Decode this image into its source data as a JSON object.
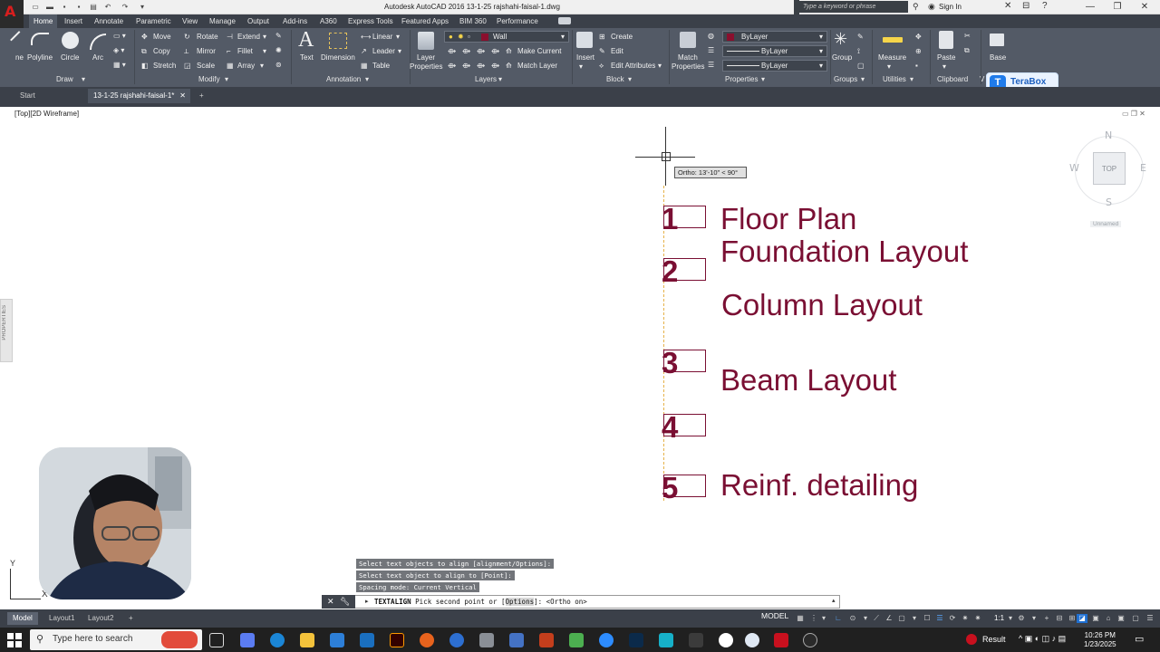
{
  "app": {
    "window_title": "Autodesk AutoCAD 2016    13-1-25 rajshahi-faisal-1.dwg",
    "search_placeholder": "Type a keyword or phrase",
    "sign_in": "Sign In"
  },
  "ribbon": {
    "tabs": [
      "Home",
      "Insert",
      "Annotate",
      "Parametric",
      "View",
      "Manage",
      "Output",
      "Add-ins",
      "A360",
      "Express Tools",
      "Featured Apps",
      "BIM 360",
      "Performance"
    ],
    "active_tab": "Home",
    "draw": {
      "title": "Draw",
      "polyline": "Polyline",
      "circle": "Circle",
      "arc": "Arc",
      "line_partial": "ne"
    },
    "modify": {
      "title": "Modify",
      "move": "Move",
      "rotate": "Rotate",
      "extend": "Extend",
      "copy": "Copy",
      "mirror": "Mirror",
      "fillet": "Fillet",
      "stretch": "Stretch",
      "scale": "Scale",
      "array": "Array"
    },
    "annotation": {
      "title": "Annotation",
      "text": "Text",
      "dimension": "Dimension",
      "linear": "Linear",
      "leader": "Leader",
      "table": "Table"
    },
    "layers": {
      "title": "Layers",
      "layer_properties_1": "Layer",
      "layer_properties_2": "Properties",
      "current_layer": "Wall",
      "make_current": "Make Current",
      "match_layer": "Match Layer"
    },
    "block": {
      "title": "Block",
      "insert": "Insert",
      "create": "Create",
      "edit": "Edit",
      "edit_attributes": "Edit Attributes"
    },
    "properties": {
      "title": "Properties",
      "match_1": "Match",
      "match_2": "Properties",
      "color": "ByLayer",
      "linetype": "ByLayer",
      "lineweight": "ByLayer"
    },
    "groups": {
      "title": "Groups",
      "group": "Group"
    },
    "utilities": {
      "title": "Utilities",
      "measure": "Measure"
    },
    "clipboard": {
      "title": "Clipboard",
      "paste": "Paste"
    },
    "view_partial": "V",
    "base": "Base"
  },
  "terabox": {
    "label": "TeraBox"
  },
  "doc_tabs": {
    "start": "Start",
    "active": "13-1-25 rajshahi-faisal-1*",
    "add": "+"
  },
  "viewport": {
    "label": "[Top][2D Wireframe]",
    "ortho_tooltip": "Ortho: 13'-10\" < 90°"
  },
  "drawing": {
    "numbers": [
      "1",
      "2",
      "3",
      "4",
      "5"
    ],
    "labels": {
      "floor_plan": "Floor Plan",
      "foundation": "Foundation Layout",
      "column": "Column Layout",
      "beam": "Beam Layout",
      "reinf": "Reinf. detailing"
    },
    "text_color": "#7a0f33"
  },
  "viewcube": {
    "n": "N",
    "s": "S",
    "e": "E",
    "w": "W",
    "top": "TOP",
    "ucs_name": "Unnamed"
  },
  "command": {
    "history": [
      "Select text objects to align [alignment/Options]:",
      "Select text object to align to [Point]:",
      "Spacing mode: Current Vertical"
    ],
    "current_cmd": "TEXTALIGN",
    "current_prompt_a": "Pick second point or [",
    "current_prompt_opt": "Options",
    "current_prompt_b": "]:  <Ortho on>"
  },
  "ucs": {
    "x": "X",
    "y": "Y"
  },
  "status": {
    "layout_tabs": [
      "Model",
      "Layout1",
      "Layout2"
    ],
    "add": "+",
    "model": "MODEL",
    "scale": "1:1"
  },
  "taskbar": {
    "search_placeholder": "Type here to search",
    "result": "Result",
    "time": "10:26 PM",
    "date": "1/23/2025"
  }
}
